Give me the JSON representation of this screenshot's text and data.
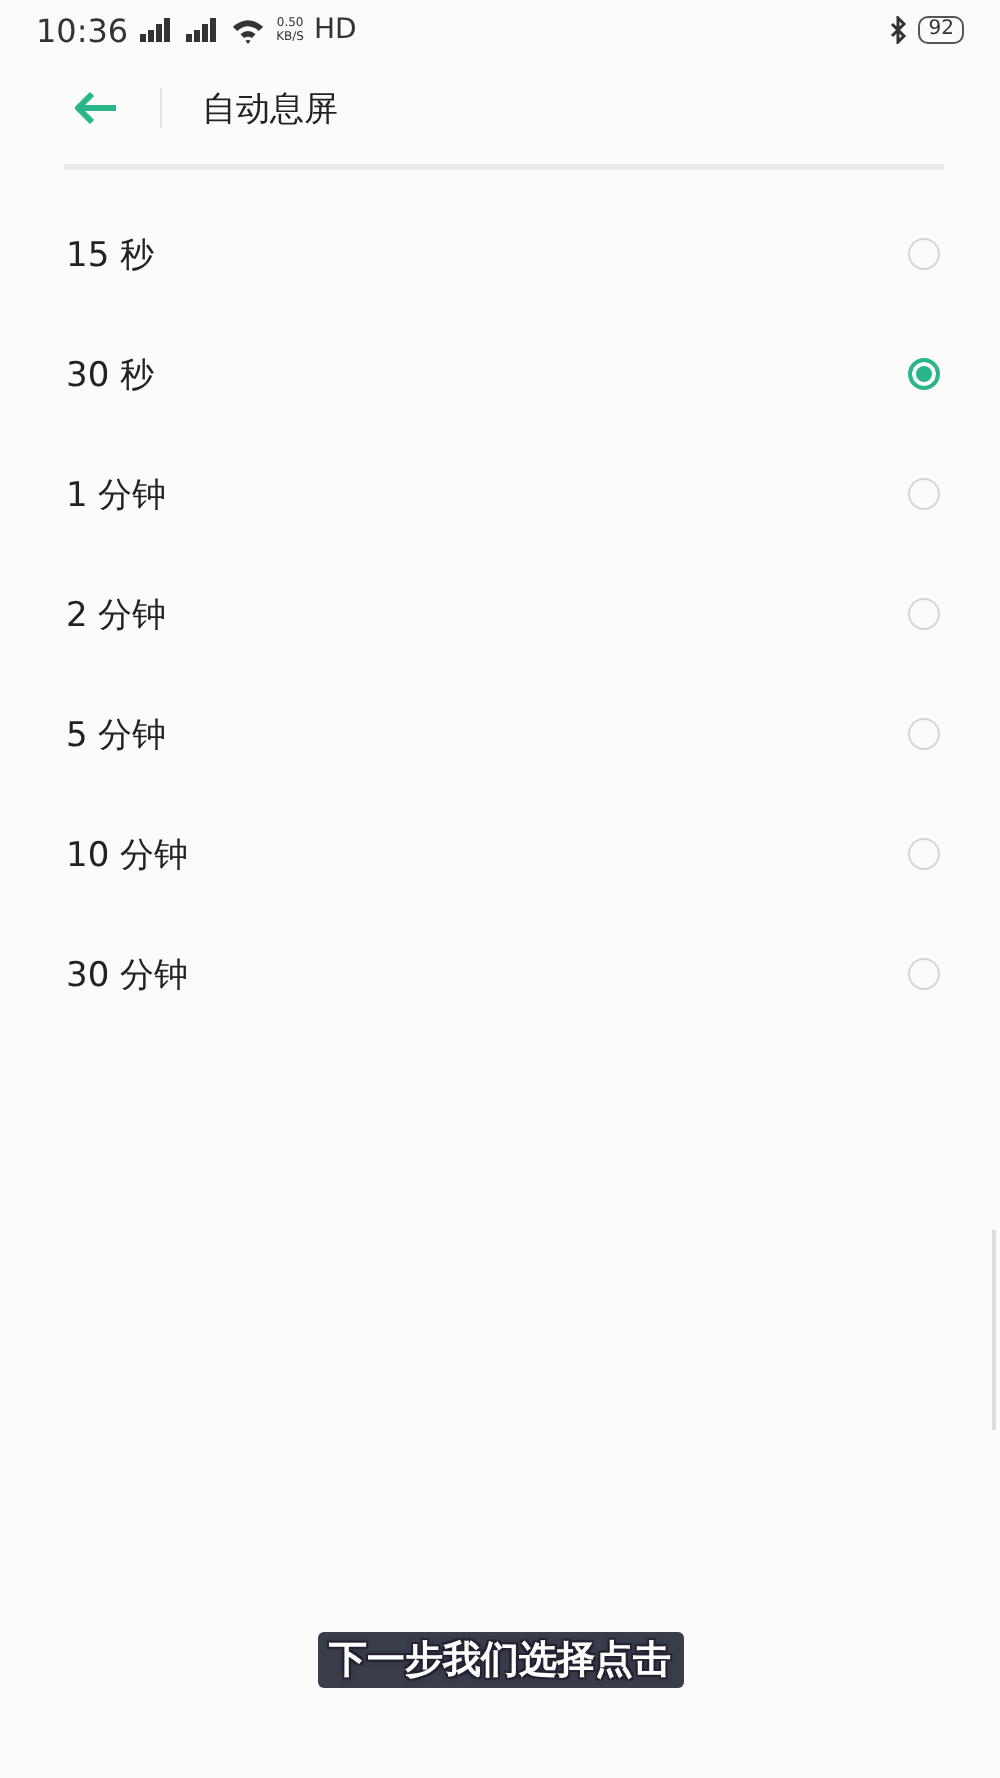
{
  "status_bar": {
    "time": "10:36",
    "net_speed": "0.50",
    "net_unit": "KB/S",
    "hd": "HD",
    "battery": "92"
  },
  "header": {
    "title": "自动息屏"
  },
  "options": [
    {
      "label": "15 秒",
      "selected": false
    },
    {
      "label": "30 秒",
      "selected": true
    },
    {
      "label": "1 分钟",
      "selected": false
    },
    {
      "label": "2 分钟",
      "selected": false
    },
    {
      "label": "5 分钟",
      "selected": false
    },
    {
      "label": "10 分钟",
      "selected": false
    },
    {
      "label": "30 分钟",
      "selected": false
    }
  ],
  "subtitle": "下一步我们选择点击"
}
